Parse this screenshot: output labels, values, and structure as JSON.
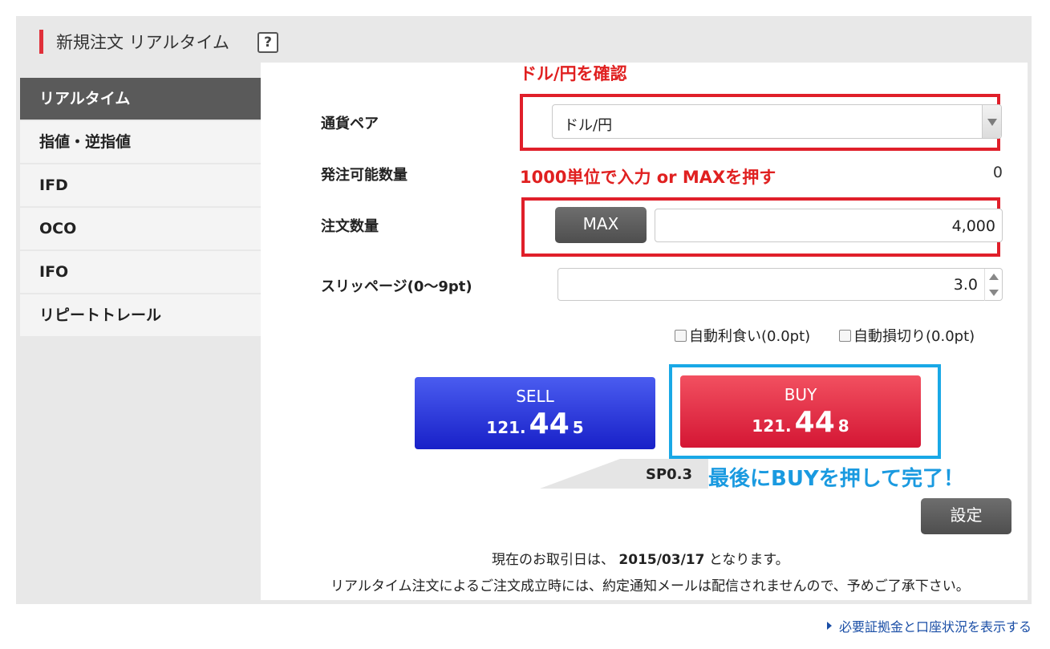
{
  "header": {
    "title": "新規注文 リアルタイム",
    "help_icon": "?"
  },
  "sidebar": {
    "items": [
      {
        "label": "リアルタイム",
        "active": true
      },
      {
        "label": "指値・逆指値"
      },
      {
        "label": "IFD"
      },
      {
        "label": "OCO"
      },
      {
        "label": "IFO"
      },
      {
        "label": "リピートトレール"
      }
    ]
  },
  "form": {
    "currency_pair_label": "通貨ペア",
    "currency_pair_value": "ドル/円",
    "available_qty_label": "発注可能数量",
    "available_qty_value": "0",
    "order_qty_label": "注文数量",
    "max_button": "MAX",
    "order_qty_value": "4,000",
    "slippage_label": "スリッページ(0〜9pt)",
    "slippage_value": "3.0",
    "auto_take_profit": "自動利食い(0.0pt)",
    "auto_stop_loss": "自動損切り(0.0pt)"
  },
  "annotations": {
    "confirm_pair": "ドル/円を確認",
    "qty_hint": "1000単位で入力 or MAXを押す",
    "buy_hint": "最後にBUYを押して完了！"
  },
  "trade": {
    "sell_label": "SELL",
    "sell_price_int": "121.",
    "sell_price_big": "44",
    "sell_price_small": "5",
    "buy_label": "BUY",
    "buy_price_int": "121.",
    "buy_price_big": "44",
    "buy_price_small": "8",
    "spread": "SP0.3"
  },
  "settings_button": "設定",
  "notes": {
    "trade_date_prefix": "現在のお取引日は、",
    "trade_date": "2015/03/17",
    "trade_date_suffix": "となります。",
    "mail_notice": "リアルタイム注文によるご注文成立時には、約定通知メールは配信されませんので、予めご了承下さい。"
  },
  "footer": {
    "link": "必要証拠金と口座状況を表示する"
  },
  "colors": {
    "sell": "#1f2bd6",
    "buy": "#e0203a",
    "annotation_red": "#e02020",
    "annotation_blue": "#1a9ae0"
  }
}
